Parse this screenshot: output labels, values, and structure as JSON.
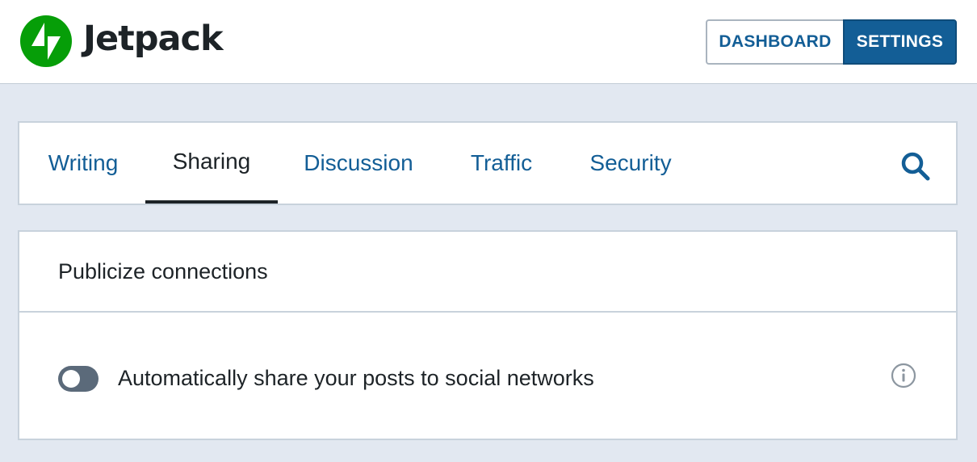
{
  "header": {
    "brand": "Jetpack",
    "logo_icon": "jetpack-bolt-logo",
    "brand_color": "#069e08",
    "buttons": {
      "dashboard": "DASHBOARD",
      "settings": "SETTINGS",
      "active": "settings"
    }
  },
  "tabs": {
    "items": [
      {
        "label": "Writing",
        "active": false
      },
      {
        "label": "Sharing",
        "active": true
      },
      {
        "label": "Discussion",
        "active": false
      },
      {
        "label": "Traffic",
        "active": false
      },
      {
        "label": "Security",
        "active": false
      }
    ],
    "search_icon": "search-icon"
  },
  "publicize": {
    "title": "Publicize connections",
    "toggle_label": "Automatically share your posts to social networks",
    "toggle_on": false,
    "info_icon": "info-icon"
  },
  "colors": {
    "accent": "#135e96",
    "background": "#e2e8f1"
  }
}
